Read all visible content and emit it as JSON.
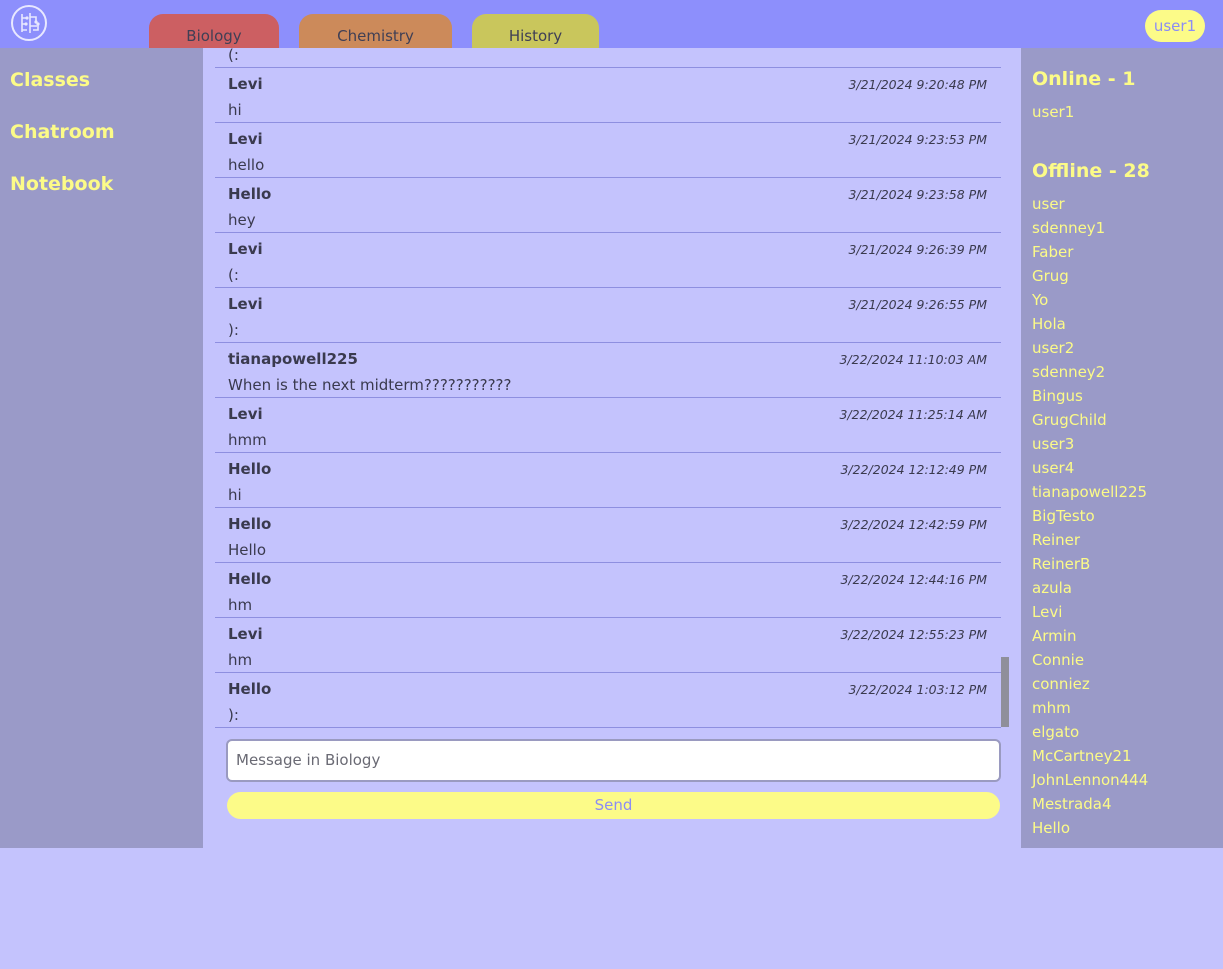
{
  "header": {
    "tabs": [
      {
        "label": "Biology"
      },
      {
        "label": "Chemistry"
      },
      {
        "label": "History"
      }
    ],
    "user_button": "user1"
  },
  "sidebar": {
    "items": [
      {
        "label": "Classes"
      },
      {
        "label": "Chatroom"
      },
      {
        "label": "Notebook"
      }
    ]
  },
  "chat": {
    "partial_first_text": "(:",
    "messages": [
      {
        "author": "Levi",
        "time": "3/21/2024 9:20:48 PM",
        "text": "hi"
      },
      {
        "author": "Levi",
        "time": "3/21/2024 9:23:53 PM",
        "text": "hello"
      },
      {
        "author": "Hello",
        "time": "3/21/2024 9:23:58 PM",
        "text": "hey"
      },
      {
        "author": "Levi",
        "time": "3/21/2024 9:26:39 PM",
        "text": "(:"
      },
      {
        "author": "Levi",
        "time": "3/21/2024 9:26:55 PM",
        "text": "):"
      },
      {
        "author": "tianapowell225",
        "time": "3/22/2024 11:10:03 AM",
        "text": "When is the next midterm???????????"
      },
      {
        "author": "Levi",
        "time": "3/22/2024 11:25:14 AM",
        "text": "hmm"
      },
      {
        "author": "Hello",
        "time": "3/22/2024 12:12:49 PM",
        "text": "hi"
      },
      {
        "author": "Hello",
        "time": "3/22/2024 12:42:59 PM",
        "text": "Hello"
      },
      {
        "author": "Hello",
        "time": "3/22/2024 12:44:16 PM",
        "text": "hm"
      },
      {
        "author": "Levi",
        "time": "3/22/2024 12:55:23 PM",
        "text": "hm"
      },
      {
        "author": "Hello",
        "time": "3/22/2024 1:03:12 PM",
        "text": "):"
      }
    ]
  },
  "composer": {
    "placeholder": "Message in Biology",
    "send_label": "Send"
  },
  "members": {
    "online_title": "Online - 1",
    "online": [
      "user1"
    ],
    "offline_title": "Offline - 28",
    "offline": [
      "user",
      "sdenney1",
      "Faber",
      "Grug",
      "Yo",
      "Hola",
      "user2",
      "sdenney2",
      "Bingus",
      "GrugChild",
      "user3",
      "user4",
      "tianapowell225",
      "BigTesto",
      "Reiner",
      "ReinerB",
      "azula",
      "Levi",
      "Armin",
      "Connie",
      "conniez",
      "mhm",
      "elgato",
      "McCartney21",
      "JohnLennon444",
      "Mestrada4",
      "Hello"
    ]
  },
  "colors": {
    "header_bg": "#8d8ffc",
    "panel_bg": "#9a9ac8",
    "chat_bg": "#c4c3fd",
    "accent_yellow": "#fcfb88",
    "tab_biology": "#cc5f62",
    "tab_chemistry": "#cc8a5a",
    "tab_history": "#c9c65c"
  }
}
